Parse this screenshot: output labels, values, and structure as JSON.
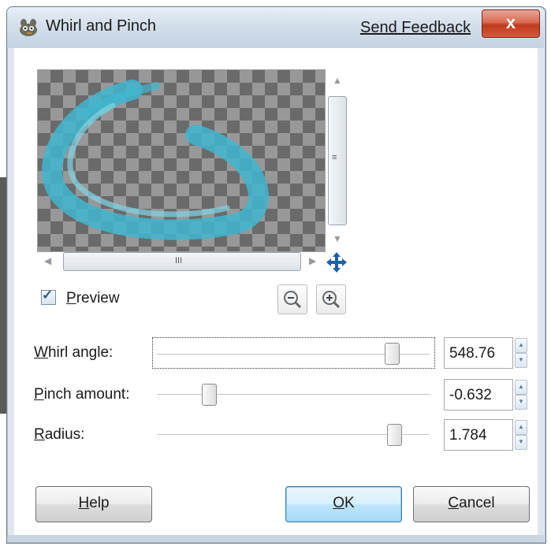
{
  "window": {
    "title": "Whirl and Pinch",
    "feedback_link": "Send Feedback",
    "close_glyph": "x"
  },
  "preview": {
    "checkbox_label": "Preview",
    "checked": true,
    "hscroll_grip": "III",
    "vscroll_grip": "≡"
  },
  "controls": [
    {
      "label": "Whirl angle:",
      "value": "548.76",
      "slider_fraction": 0.86
    },
    {
      "label": "Pinch amount:",
      "value": "-0.632",
      "slider_fraction": 0.19
    },
    {
      "label": "Radius:",
      "value": "1.784",
      "slider_fraction": 0.87
    }
  ],
  "buttons": {
    "help": "Help",
    "ok": "OK",
    "cancel": "Cancel"
  },
  "icons": {
    "app": "gimp-wilber-icon",
    "move": "move-arrows-icon",
    "zoom_out": "zoom-out-icon",
    "zoom_in": "zoom-in-icon"
  },
  "colors": {
    "whirl_stroke": "#3fb6cf",
    "close_button": "#c9452a"
  }
}
